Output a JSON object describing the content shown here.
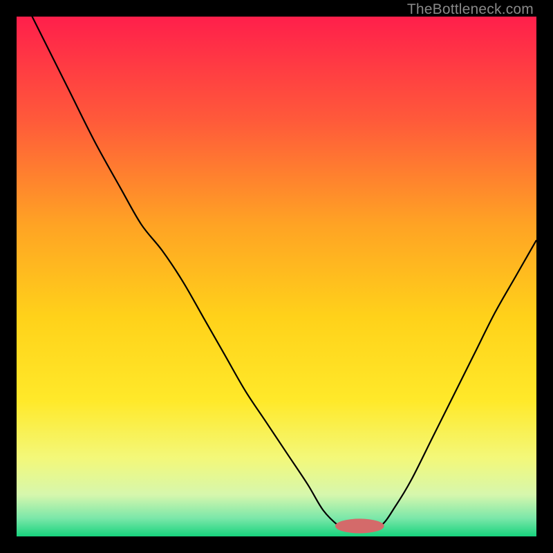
{
  "watermark": "TheBottleneck.com",
  "chart_data": {
    "type": "line",
    "title": "",
    "xlabel": "",
    "ylabel": "",
    "xlim": [
      0,
      100
    ],
    "ylim": [
      0,
      100
    ],
    "grid": false,
    "legend": false,
    "background_gradient_stops": [
      {
        "offset": 0.0,
        "color": "#ff1f4b"
      },
      {
        "offset": 0.2,
        "color": "#ff5a3a"
      },
      {
        "offset": 0.4,
        "color": "#ffa324"
      },
      {
        "offset": 0.58,
        "color": "#ffd21a"
      },
      {
        "offset": 0.74,
        "color": "#ffe92a"
      },
      {
        "offset": 0.85,
        "color": "#f3f87a"
      },
      {
        "offset": 0.92,
        "color": "#d6f7ad"
      },
      {
        "offset": 0.965,
        "color": "#7be7a9"
      },
      {
        "offset": 1.0,
        "color": "#17d37d"
      }
    ],
    "marker": {
      "x": 66,
      "y": 2,
      "rx": 4.7,
      "ry": 1.4,
      "color": "#d46a6a"
    },
    "series": [
      {
        "name": "bottleneck-curve",
        "color": "#000000",
        "x": [
          0,
          5,
          10,
          15,
          20,
          24,
          28,
          32,
          36,
          40,
          44,
          48,
          52,
          56,
          59,
          62,
          64,
          66,
          70,
          73,
          76,
          80,
          84,
          88,
          92,
          96,
          100
        ],
        "y": [
          106,
          96,
          86,
          76,
          67,
          60,
          55,
          49,
          42,
          35,
          28,
          22,
          16,
          10,
          5,
          2,
          1,
          1,
          2,
          6,
          11,
          19,
          27,
          35,
          43,
          50,
          57
        ]
      }
    ]
  }
}
